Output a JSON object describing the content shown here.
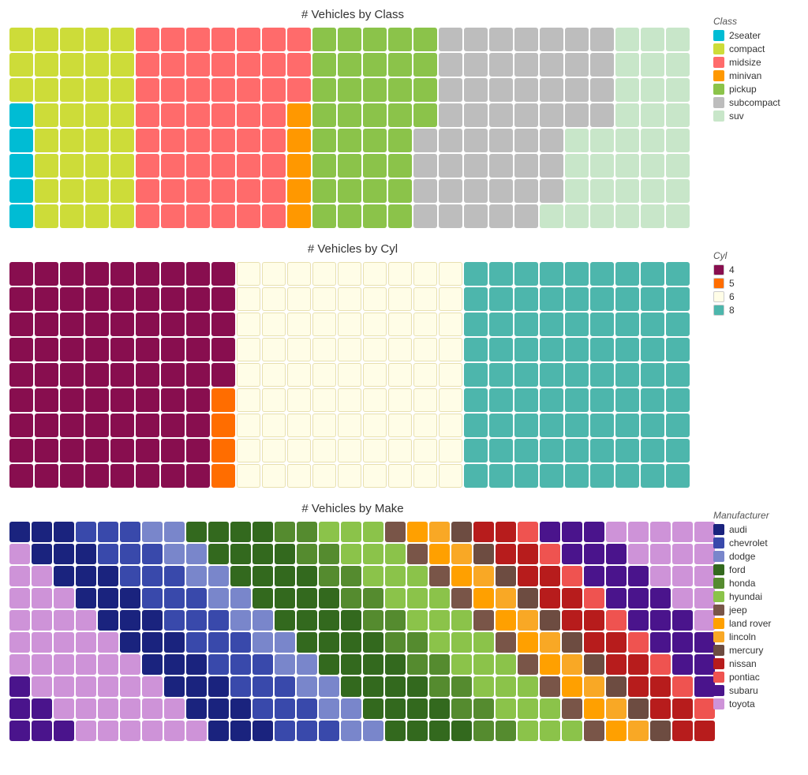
{
  "charts": [
    {
      "id": "class",
      "title": "# Vehicles by Class",
      "legend_title": "Class",
      "legend": [
        {
          "label": "2seater",
          "color": "#00BCD4"
        },
        {
          "label": "compact",
          "color": "#CDDC39"
        },
        {
          "label": "midsize",
          "color": "#FF6B6B"
        },
        {
          "label": "minivan",
          "color": "#FF9800"
        },
        {
          "label": "pickup",
          "color": "#8BC34A"
        },
        {
          "label": "subcompact",
          "color": "#BDBDBD"
        },
        {
          "label": "suv",
          "color": "#C8E6C9"
        }
      ],
      "cells": [
        "compact",
        "compact",
        "compact",
        "compact",
        "compact",
        "midsize",
        "midsize",
        "midsize",
        "midsize",
        "midsize",
        "midsize",
        "midsize",
        "pickup",
        "pickup",
        "pickup",
        "pickup",
        "pickup",
        "subcompact",
        "subcompact",
        "subcompact",
        "subcompact",
        "subcompact",
        "subcompact",
        "subcompact",
        "suv",
        "suv",
        "suv",
        "compact",
        "compact",
        "compact",
        "compact",
        "compact",
        "midsize",
        "midsize",
        "midsize",
        "midsize",
        "midsize",
        "midsize",
        "midsize",
        "pickup",
        "pickup",
        "pickup",
        "pickup",
        "pickup",
        "subcompact",
        "subcompact",
        "subcompact",
        "subcompact",
        "subcompact",
        "subcompact",
        "subcompact",
        "suv",
        "suv",
        "suv",
        "compact",
        "compact",
        "compact",
        "compact",
        "compact",
        "midsize",
        "midsize",
        "midsize",
        "midsize",
        "midsize",
        "midsize",
        "midsize",
        "pickup",
        "pickup",
        "pickup",
        "pickup",
        "pickup",
        "subcompact",
        "subcompact",
        "subcompact",
        "subcompact",
        "subcompact",
        "subcompact",
        "subcompact",
        "suv",
        "suv",
        "suv",
        "2seater",
        "compact",
        "compact",
        "compact",
        "compact",
        "midsize",
        "midsize",
        "midsize",
        "midsize",
        "midsize",
        "midsize",
        "minivan",
        "pickup",
        "pickup",
        "pickup",
        "pickup",
        "pickup",
        "subcompact",
        "subcompact",
        "subcompact",
        "subcompact",
        "subcompact",
        "subcompact",
        "subcompact",
        "suv",
        "suv",
        "suv",
        "2seater",
        "compact",
        "compact",
        "compact",
        "compact",
        "midsize",
        "midsize",
        "midsize",
        "midsize",
        "midsize",
        "midsize",
        "minivan",
        "pickup",
        "pickup",
        "pickup",
        "pickup",
        "subcompact",
        "subcompact",
        "subcompact",
        "subcompact",
        "subcompact",
        "subcompact",
        "suv",
        "suv",
        "suv",
        "suv",
        "suv",
        "2seater",
        "compact",
        "compact",
        "compact",
        "compact",
        "midsize",
        "midsize",
        "midsize",
        "midsize",
        "midsize",
        "midsize",
        "minivan",
        "pickup",
        "pickup",
        "pickup",
        "pickup",
        "subcompact",
        "subcompact",
        "subcompact",
        "subcompact",
        "subcompact",
        "subcompact",
        "suv",
        "suv",
        "suv",
        "suv",
        "suv",
        "2seater",
        "compact",
        "compact",
        "compact",
        "compact",
        "midsize",
        "midsize",
        "midsize",
        "midsize",
        "midsize",
        "midsize",
        "minivan",
        "pickup",
        "pickup",
        "pickup",
        "pickup",
        "subcompact",
        "subcompact",
        "subcompact",
        "subcompact",
        "subcompact",
        "subcompact",
        "suv",
        "suv",
        "suv",
        "suv",
        "suv",
        "2seater",
        "compact",
        "compact",
        "compact",
        "compact",
        "midsize",
        "midsize",
        "midsize",
        "midsize",
        "midsize",
        "midsize",
        "minivan",
        "pickup",
        "pickup",
        "pickup",
        "pickup",
        "subcompact",
        "subcompact",
        "subcompact",
        "subcompact",
        "subcompact",
        "suv",
        "suv",
        "suv",
        "suv",
        "suv",
        "suv"
      ],
      "cols": 27
    },
    {
      "id": "cyl",
      "title": "# Vehicles by Cyl",
      "legend_title": "Cyl",
      "legend": [
        {
          "label": "4",
          "color": "#880E4F"
        },
        {
          "label": "5",
          "color": "#FF6D00"
        },
        {
          "label": "6",
          "color": "#FFFDE7"
        },
        {
          "label": "8",
          "color": "#4DB6AC"
        }
      ],
      "cells": [
        "4",
        "4",
        "4",
        "4",
        "4",
        "4",
        "4",
        "4",
        "4",
        "6",
        "6",
        "6",
        "6",
        "6",
        "6",
        "6",
        "6",
        "6",
        "8",
        "8",
        "8",
        "8",
        "8",
        "8",
        "8",
        "8",
        "8",
        "4",
        "4",
        "4",
        "4",
        "4",
        "4",
        "4",
        "4",
        "4",
        "6",
        "6",
        "6",
        "6",
        "6",
        "6",
        "6",
        "6",
        "6",
        "8",
        "8",
        "8",
        "8",
        "8",
        "8",
        "8",
        "8",
        "8",
        "4",
        "4",
        "4",
        "4",
        "4",
        "4",
        "4",
        "4",
        "4",
        "6",
        "6",
        "6",
        "6",
        "6",
        "6",
        "6",
        "6",
        "6",
        "8",
        "8",
        "8",
        "8",
        "8",
        "8",
        "8",
        "8",
        "8",
        "4",
        "4",
        "4",
        "4",
        "4",
        "4",
        "4",
        "4",
        "4",
        "6",
        "6",
        "6",
        "6",
        "6",
        "6",
        "6",
        "6",
        "6",
        "8",
        "8",
        "8",
        "8",
        "8",
        "8",
        "8",
        "8",
        "8",
        "4",
        "4",
        "4",
        "4",
        "4",
        "4",
        "4",
        "4",
        "4",
        "6",
        "6",
        "6",
        "6",
        "6",
        "6",
        "6",
        "6",
        "6",
        "8",
        "8",
        "8",
        "8",
        "8",
        "8",
        "8",
        "8",
        "8",
        "4",
        "4",
        "4",
        "4",
        "4",
        "4",
        "4",
        "4",
        "5",
        "6",
        "6",
        "6",
        "6",
        "6",
        "6",
        "6",
        "6",
        "6",
        "8",
        "8",
        "8",
        "8",
        "8",
        "8",
        "8",
        "8",
        "8",
        "4",
        "4",
        "4",
        "4",
        "4",
        "4",
        "4",
        "4",
        "5",
        "6",
        "6",
        "6",
        "6",
        "6",
        "6",
        "6",
        "6",
        "6",
        "8",
        "8",
        "8",
        "8",
        "8",
        "8",
        "8",
        "8",
        "8",
        "4",
        "4",
        "4",
        "4",
        "4",
        "4",
        "4",
        "4",
        "5",
        "6",
        "6",
        "6",
        "6",
        "6",
        "6",
        "6",
        "6",
        "6",
        "8",
        "8",
        "8",
        "8",
        "8",
        "8",
        "8",
        "8",
        "8",
        "4",
        "4",
        "4",
        "4",
        "4",
        "4",
        "4",
        "4",
        "5",
        "6",
        "6",
        "6",
        "6",
        "6",
        "6",
        "6",
        "6",
        "6",
        "8",
        "8",
        "8",
        "8",
        "8",
        "8",
        "8",
        "8",
        "8"
      ],
      "cols": 27
    },
    {
      "id": "make",
      "title": "# Vehicles by Make",
      "legend_title": "Manufacturer",
      "legend": [
        {
          "label": "audi",
          "color": "#1A237E"
        },
        {
          "label": "chevrolet",
          "color": "#3949AB"
        },
        {
          "label": "dodge",
          "color": "#7986CB"
        },
        {
          "label": "ford",
          "color": "#33691E"
        },
        {
          "label": "honda",
          "color": "#558B2F"
        },
        {
          "label": "hyundai",
          "color": "#8BC34A"
        },
        {
          "label": "jeep",
          "color": "#795548"
        },
        {
          "label": "land rover",
          "color": "#FFA000"
        },
        {
          "label": "lincoln",
          "color": "#F9A825"
        },
        {
          "label": "mercury",
          "color": "#6D4C41"
        },
        {
          "label": "nissan",
          "color": "#B71C1C"
        },
        {
          "label": "pontiac",
          "color": "#EF5350"
        },
        {
          "label": "subaru",
          "color": "#4A148C"
        },
        {
          "label": "toyota",
          "color": "#CE93D8"
        }
      ],
      "cells_layout": "14col",
      "cols": 32
    }
  ]
}
